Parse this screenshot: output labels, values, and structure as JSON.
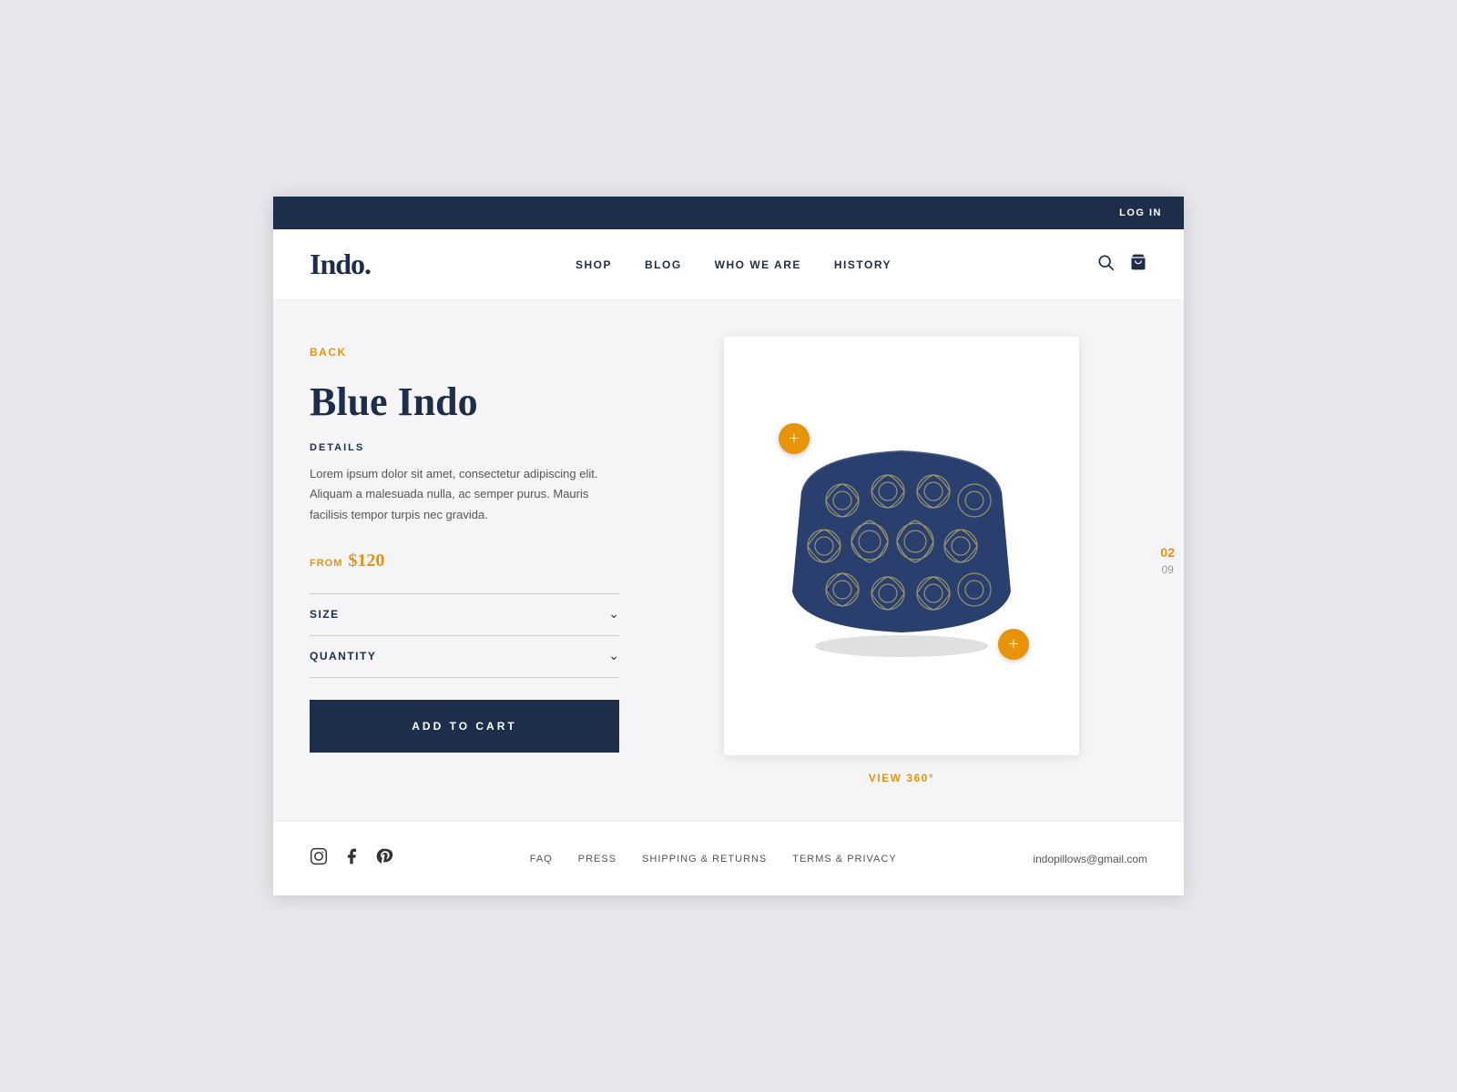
{
  "topbar": {
    "login_label": "LOG IN"
  },
  "header": {
    "logo": "Indo.",
    "nav": {
      "items": [
        {
          "label": "SHOP"
        },
        {
          "label": "BLOG"
        },
        {
          "label": "WHO WE ARE"
        },
        {
          "label": "HISTORY"
        }
      ]
    }
  },
  "product": {
    "back_label": "BACK",
    "title": "Blue Indo",
    "details_label": "DETAILS",
    "description": "Lorem ipsum dolor sit amet, consectetur adipiscing elit. Aliquam a malesuada nulla, ac semper purus. Mauris facilisis tempor turpis nec gravida.",
    "from_label": "FROM",
    "price": "$120",
    "size_label": "SIZE",
    "quantity_label": "QUANTITY",
    "add_to_cart_label": "ADD TO CART",
    "view_360_label": "VIEW 360°",
    "pagination": {
      "current": "02",
      "total": "09"
    }
  },
  "footer": {
    "links": [
      {
        "label": "FAQ"
      },
      {
        "label": "PRESS"
      },
      {
        "label": "SHIPPING & RETURNS"
      },
      {
        "label": "TERMS & PRIVACY"
      }
    ],
    "email": "indopillows@gmail.com"
  }
}
